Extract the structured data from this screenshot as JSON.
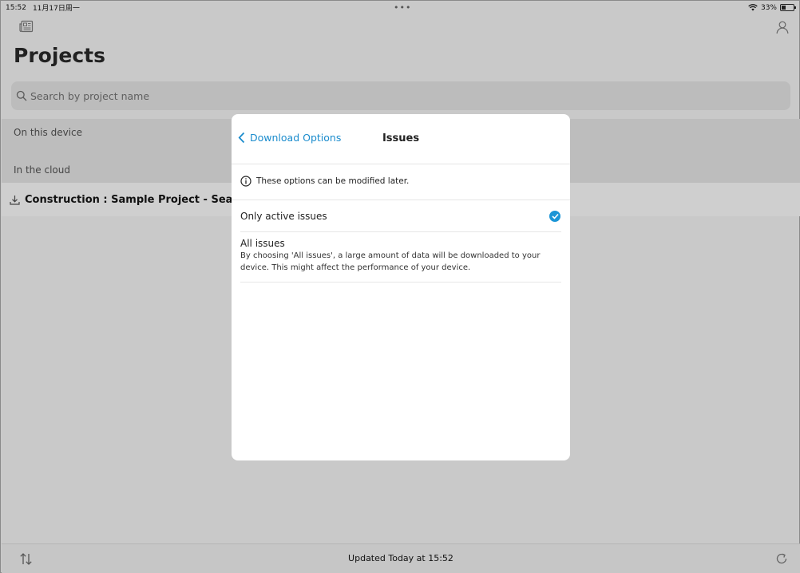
{
  "statusbar": {
    "time": "15:52",
    "date": "11月17日周一",
    "dots": "•••",
    "battery": "33%"
  },
  "header": {
    "title": "Projects"
  },
  "search": {
    "placeholder": "Search by project name"
  },
  "sections": {
    "on_device": "On this device",
    "in_cloud": "In the cloud"
  },
  "projects": [
    {
      "name": "Construction : Sample Project - Seaport C"
    }
  ],
  "modal": {
    "back_label": "Download Options",
    "title": "Issues",
    "info": "These options can be modified later.",
    "options": [
      {
        "title": "Only active issues",
        "selected": true
      },
      {
        "title": "All issues",
        "description_line1": "By choosing 'All issues', a large amount of data will be downloaded to your",
        "description_line2": "device. This might affect the performance of your device.",
        "selected": false
      }
    ]
  },
  "footer": {
    "updated": "Updated Today at 15:52"
  },
  "colors": {
    "accent": "#1b8ccd",
    "check": "#1b95d6"
  },
  "icons": {
    "top_left": "news-icon",
    "top_right": "person-icon",
    "search": "search-icon",
    "project": "download-icon",
    "bottom_left": "sort-icon",
    "bottom_right": "refresh-icon",
    "back": "chevron-left-icon",
    "info": "info-icon",
    "check": "checkmark-icon"
  }
}
